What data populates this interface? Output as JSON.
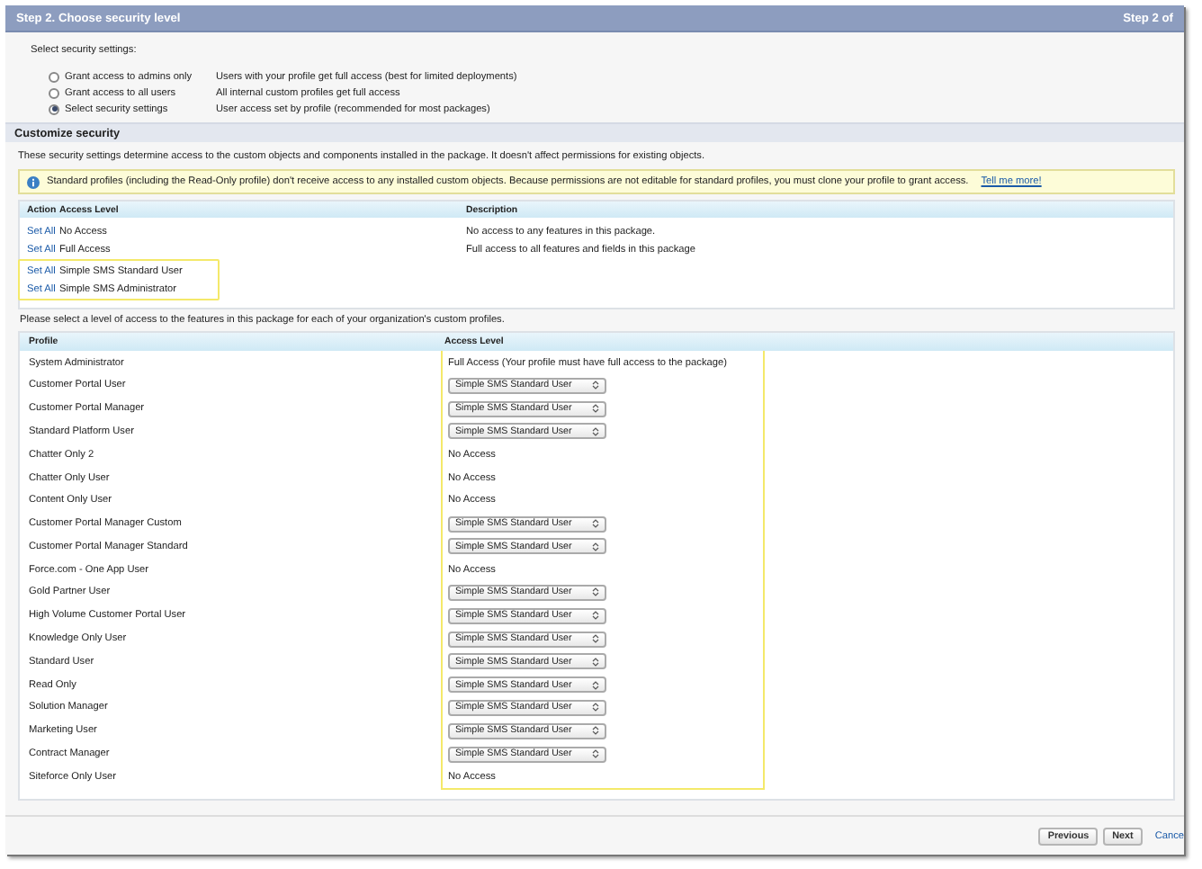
{
  "header": {
    "title": "Step 2. Choose security level",
    "step": "Step 2 of"
  },
  "security_settings": {
    "label": "Select security settings:",
    "options": [
      {
        "label": "Grant access to admins only",
        "description": "Users with your profile get full access (best for limited deployments)",
        "selected": false
      },
      {
        "label": "Grant access to all users",
        "description": "All internal custom profiles get full access",
        "selected": false
      },
      {
        "label": "Select security settings",
        "description": "User access set by profile (recommended for most packages)",
        "selected": true
      }
    ]
  },
  "customize_security": {
    "title": "Customize security",
    "description": "These security settings determine access to the custom objects and components installed in the package. It doesn't affect permissions for existing objects.",
    "info": {
      "text": "Standard profiles (including the Read-Only profile) don't receive access to any installed custom objects. Because permissions are not editable for standard profiles, you must clone your profile to grant access.",
      "link": "Tell me more!"
    }
  },
  "access_levels": {
    "columns": [
      "Action",
      "Access Level",
      "Description"
    ],
    "rows": [
      {
        "action": "Set All",
        "level": "No Access",
        "description": "No access to any features in this package.",
        "highlighted": false
      },
      {
        "action": "Set All",
        "level": "Full Access",
        "description": "Full access to all features and fields in this package",
        "highlighted": false
      },
      {
        "action": "Set All",
        "level": "Simple SMS Standard User",
        "highlighted": true
      },
      {
        "action": "Set All",
        "level": "Simple SMS Administrator",
        "highlighted": true
      }
    ]
  },
  "profiles": {
    "instruction": "Please select a level of access to the features in this package for each of your organization's custom profiles.",
    "columns": [
      "Profile",
      "Access Level"
    ],
    "highlighted": true,
    "rows": [
      {
        "profile": "System Administrator",
        "kind": "text",
        "access": "Full Access (Your profile must have full access to the package)"
      },
      {
        "profile": "Customer Portal User",
        "kind": "select",
        "access": "Simple SMS Standard User"
      },
      {
        "profile": "Customer Portal Manager",
        "kind": "select",
        "access": "Simple SMS Standard User"
      },
      {
        "profile": "Standard Platform User",
        "kind": "select",
        "access": "Simple SMS Standard User"
      },
      {
        "profile": "Chatter Only 2",
        "kind": "text",
        "access": "No Access"
      },
      {
        "profile": "Chatter Only User",
        "kind": "text",
        "access": "No Access"
      },
      {
        "profile": "Content Only User",
        "kind": "text",
        "access": "No Access"
      },
      {
        "profile": "Customer Portal Manager Custom",
        "kind": "select",
        "access": "Simple SMS Standard User"
      },
      {
        "profile": "Customer Portal Manager Standard",
        "kind": "select",
        "access": "Simple SMS Standard User"
      },
      {
        "profile": "Force.com - One App User",
        "kind": "text",
        "access": "No Access"
      },
      {
        "profile": "Gold Partner User",
        "kind": "select",
        "access": "Simple SMS Standard User"
      },
      {
        "profile": "High Volume Customer Portal User",
        "kind": "select",
        "access": "Simple SMS Standard User"
      },
      {
        "profile": "Knowledge Only User",
        "kind": "select",
        "access": "Simple SMS Standard User"
      },
      {
        "profile": "Standard User",
        "kind": "select",
        "access": "Simple SMS Standard User"
      },
      {
        "profile": "Read Only",
        "kind": "select",
        "access": "Simple SMS Standard User"
      },
      {
        "profile": "Solution Manager",
        "kind": "select",
        "access": "Simple SMS Standard User"
      },
      {
        "profile": "Marketing User",
        "kind": "select",
        "access": "Simple SMS Standard User"
      },
      {
        "profile": "Contract Manager",
        "kind": "select",
        "access": "Simple SMS Standard User"
      },
      {
        "profile": "Siteforce Only User",
        "kind": "text",
        "access": "No Access"
      }
    ]
  },
  "buttons": [
    {
      "label": "Previous",
      "kind": "button"
    },
    {
      "label": "Next",
      "kind": "button"
    },
    {
      "label": "Cance",
      "kind": "link"
    }
  ]
}
